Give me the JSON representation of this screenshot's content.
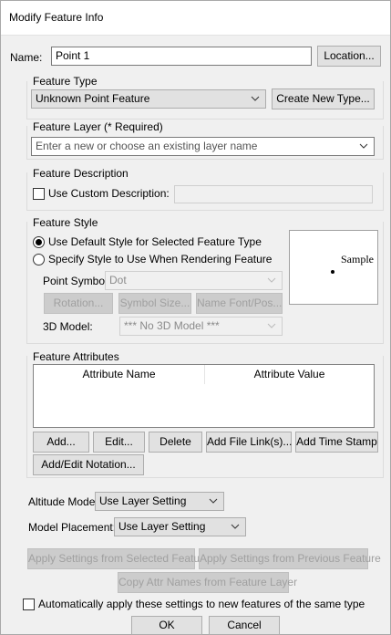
{
  "window": {
    "title": "Modify Feature Info"
  },
  "name": {
    "label": "Name:",
    "value": "Point 1",
    "location_button": "Location..."
  },
  "feature_type": {
    "group_label": "Feature Type",
    "selected": "Unknown Point Feature",
    "create_button": "Create New Type..."
  },
  "feature_layer": {
    "group_label": "Feature Layer (* Required)",
    "placeholder": "Enter a new or choose an existing layer name"
  },
  "feature_description": {
    "group_label": "Feature Description",
    "checkbox_label": "Use Custom Description:",
    "checked": false
  },
  "feature_style": {
    "group_label": "Feature Style",
    "radio_default": "Use Default Style for Selected Feature Type",
    "radio_specify": "Specify Style to Use When Rendering Feature",
    "selected_radio": "default",
    "point_symbol_label": "Point Symbol",
    "point_symbol_value": "Dot",
    "rotation_button": "Rotation...",
    "symbol_size_button": "Symbol Size...",
    "name_font_button": "Name Font/Pos...",
    "model_label": "3D Model:",
    "model_value": "*** No 3D Model ***",
    "preview_text": "Sample"
  },
  "feature_attributes": {
    "group_label": "Feature Attributes",
    "columns": [
      "Attribute Name",
      "Attribute Value"
    ],
    "rows": [],
    "buttons": {
      "add": "Add...",
      "edit": "Edit...",
      "delete": "Delete",
      "add_file_link": "Add File Link(s)...",
      "add_time_stamp": "Add Time Stamp",
      "add_edit_notation": "Add/Edit Notation..."
    }
  },
  "altitude_mode": {
    "label": "Altitude Mode:",
    "value": "Use Layer Setting"
  },
  "model_placement": {
    "label": "Model Placement:",
    "value": "Use Layer Setting"
  },
  "apply_buttons": {
    "from_selected": "Apply Settings from Selected Feature",
    "from_previous": "Apply Settings from Previous Feature",
    "copy_attr": "Copy Attr Names from Feature Layer"
  },
  "auto_apply": {
    "label": "Automatically apply these settings to new features of the same type",
    "checked": false
  },
  "footer": {
    "ok": "OK",
    "cancel": "Cancel"
  }
}
